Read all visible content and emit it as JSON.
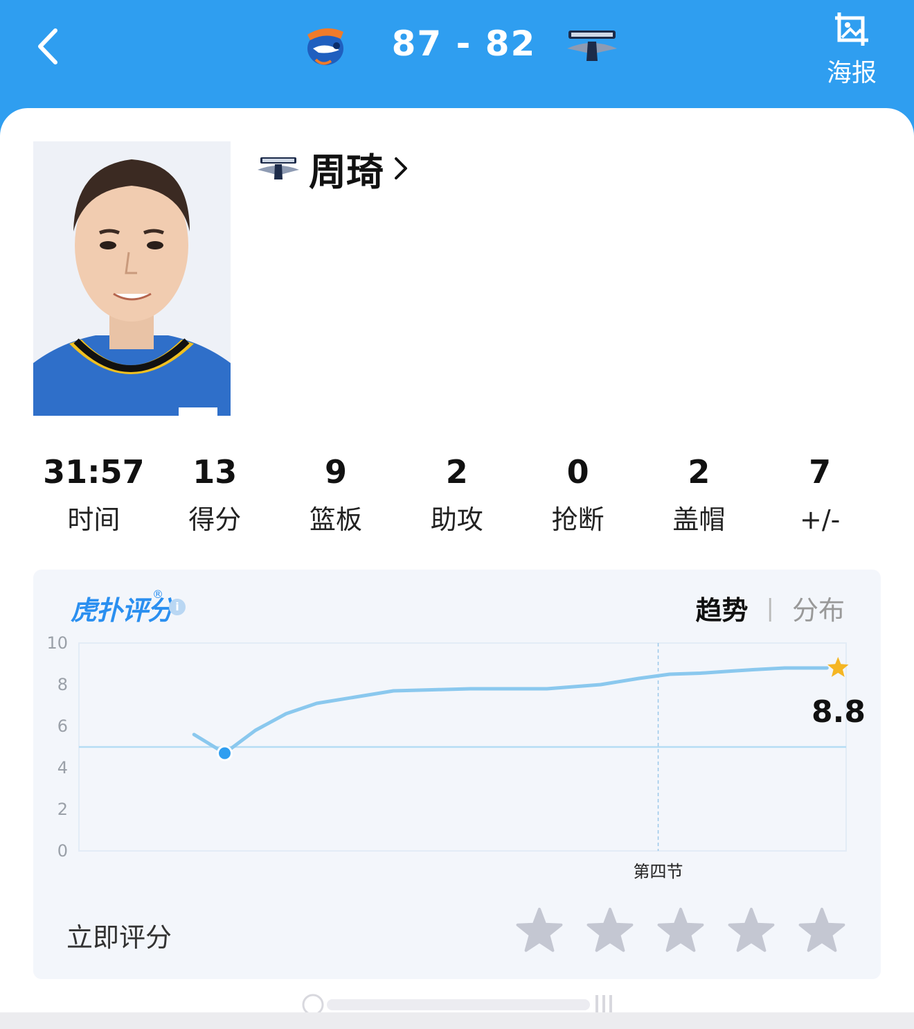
{
  "header": {
    "score": "87  -  82",
    "poster_label": "海报",
    "back_icon": "chevron-left-icon",
    "poster_icon": "image-crop-icon",
    "home_logo": "sharks-logo",
    "away_logo": "ducks-logo",
    "bg_color": "#2f9ef0"
  },
  "player": {
    "name": "周琦",
    "team_logo": "ducks-logo"
  },
  "stats": [
    {
      "value": "31:57",
      "label": "时间"
    },
    {
      "value": "13",
      "label": "得分"
    },
    {
      "value": "9",
      "label": "篮板"
    },
    {
      "value": "2",
      "label": "助攻"
    },
    {
      "value": "0",
      "label": "抢断"
    },
    {
      "value": "2",
      "label": "盖帽"
    },
    {
      "value": "7",
      "label": "+/-"
    }
  ],
  "rating": {
    "brand": "虎扑评分",
    "brand_mark": "®",
    "info": "i",
    "tab_trend": "趋势",
    "tab_separator": "|",
    "tab_distribution": "分布",
    "rate_now": "立即评分",
    "star_count": 5
  },
  "chart_data": {
    "type": "line",
    "ylim": [
      0,
      10
    ],
    "yticks": [
      "0",
      "2",
      "4",
      "6",
      "8",
      "10"
    ],
    "xlabel_marker": "第四节",
    "baseline": 5.0,
    "current_value": "8.8",
    "series": [
      {
        "x": [
          0.15,
          0.19,
          0.23,
          0.27,
          0.31,
          0.36,
          0.41,
          0.46,
          0.51,
          0.55,
          0.61,
          0.68,
          0.73,
          0.77,
          0.81,
          0.85,
          0.88,
          0.92,
          0.96,
          0.975
        ],
        "values": [
          5.6,
          4.7,
          5.8,
          6.6,
          7.1,
          7.4,
          7.7,
          7.75,
          7.8,
          7.8,
          7.8,
          8.0,
          8.3,
          8.5,
          8.55,
          8.65,
          8.72,
          8.8,
          8.8,
          8.8
        ]
      }
    ],
    "highlight_point_index": 1,
    "quarter_marker_x": 0.755,
    "line_color": "#8ac8ee",
    "point_color": "#2f9ef0",
    "star_color": "#f5b623"
  }
}
